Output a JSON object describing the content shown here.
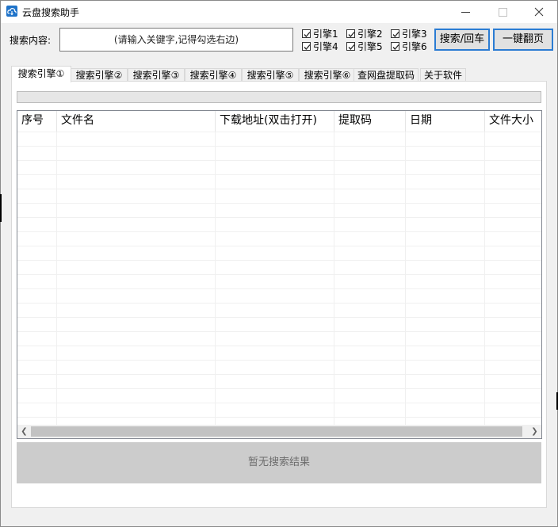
{
  "window": {
    "title": "云盘搜索助手",
    "controls": {
      "minimize": "—",
      "maximize": "□",
      "close": "✕"
    }
  },
  "search": {
    "label": "搜索内容:",
    "placeholder": "(请输入关键字,记得勾选右边)",
    "value": ""
  },
  "engines": [
    {
      "label": "引擎1",
      "checked": true
    },
    {
      "label": "引擎2",
      "checked": true
    },
    {
      "label": "引擎3",
      "checked": true
    },
    {
      "label": "引擎4",
      "checked": true
    },
    {
      "label": "引擎5",
      "checked": true
    },
    {
      "label": "引擎6",
      "checked": true
    }
  ],
  "buttons": {
    "search": "搜索/回车",
    "flip_page": "一键翻页"
  },
  "tabs": [
    {
      "label": "搜索引擎①",
      "active": true
    },
    {
      "label": "搜索引擎②",
      "active": false
    },
    {
      "label": "搜索引擎③",
      "active": false
    },
    {
      "label": "搜索引擎④",
      "active": false
    },
    {
      "label": "搜索引擎⑤",
      "active": false
    },
    {
      "label": "搜索引擎⑥",
      "active": false
    },
    {
      "label": "查网盘提取码",
      "active": false
    },
    {
      "label": "关于软件",
      "active": false
    }
  ],
  "progress": {
    "value": 0
  },
  "table": {
    "columns": [
      "序号",
      "文件名",
      "下载地址(双击打开)",
      "提取码",
      "日期",
      "文件大小"
    ],
    "rows": []
  },
  "status": {
    "no_result": "暂无搜索结果"
  },
  "colors": {
    "accent": "#2b7cd3",
    "window_bg": "#f0f0f0",
    "status_bg": "#cccccc",
    "status_text": "#6d6d6d"
  }
}
